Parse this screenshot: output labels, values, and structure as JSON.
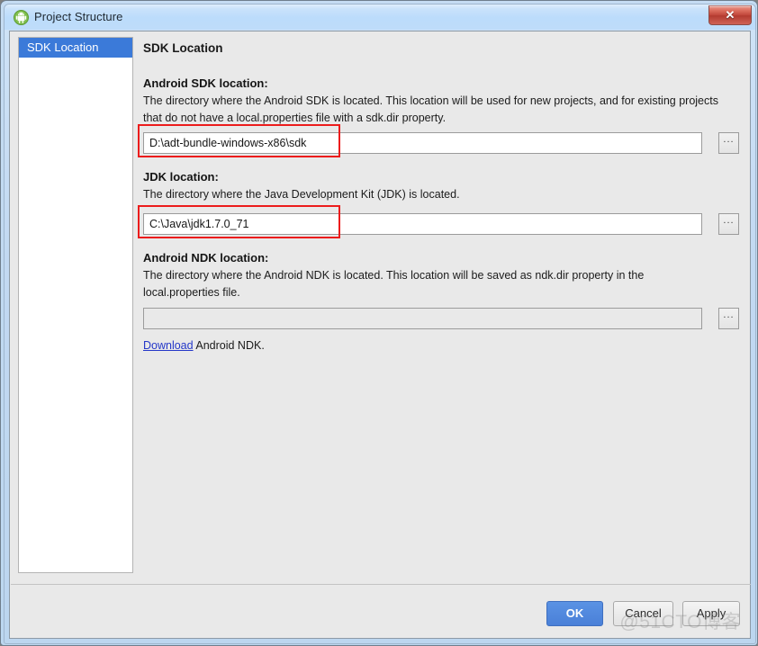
{
  "window": {
    "title": "Project Structure",
    "icon": "android-robot-icon",
    "close_label": "✕"
  },
  "sidebar": {
    "items": [
      {
        "label": "SDK Location",
        "selected": true
      }
    ]
  },
  "pane": {
    "title": "SDK Location",
    "sections": [
      {
        "label": "Android SDK location:",
        "description": "The directory where the Android SDK is located. This location will be used for new projects, and for existing projects that do not have a local.properties file with a sdk.dir property.",
        "value": "D:\\adt-bundle-windows-x86\\sdk",
        "placeholder": "",
        "browse_label": "...",
        "disabled": false,
        "highlighted": true
      },
      {
        "label": "JDK location:",
        "description": "The directory where the Java Development Kit (JDK) is located.",
        "value": "C:\\Java\\jdk1.7.0_71",
        "placeholder": "",
        "browse_label": "...",
        "disabled": false,
        "highlighted": true
      },
      {
        "label": "Android NDK location:",
        "description": "The directory where the Android NDK is located. This location will be saved as ndk.dir property in the local.properties file.",
        "value": "",
        "placeholder": "",
        "browse_label": "...",
        "disabled": true,
        "highlighted": false
      }
    ],
    "download_link": "Download",
    "download_suffix": " Android NDK."
  },
  "footer": {
    "ok_label": "OK",
    "cancel_label": "Cancel",
    "apply_label": "Apply"
  },
  "watermark": "@51CTO博客",
  "colors": {
    "accent_blue": "#3b7ad9",
    "primary_button": "#4a80d8",
    "annotation_red": "#ec1c1c",
    "link_blue": "#2437c8",
    "titlebar_blue": "#bcdcfb",
    "dialog_bg": "#e9e9e9"
  }
}
